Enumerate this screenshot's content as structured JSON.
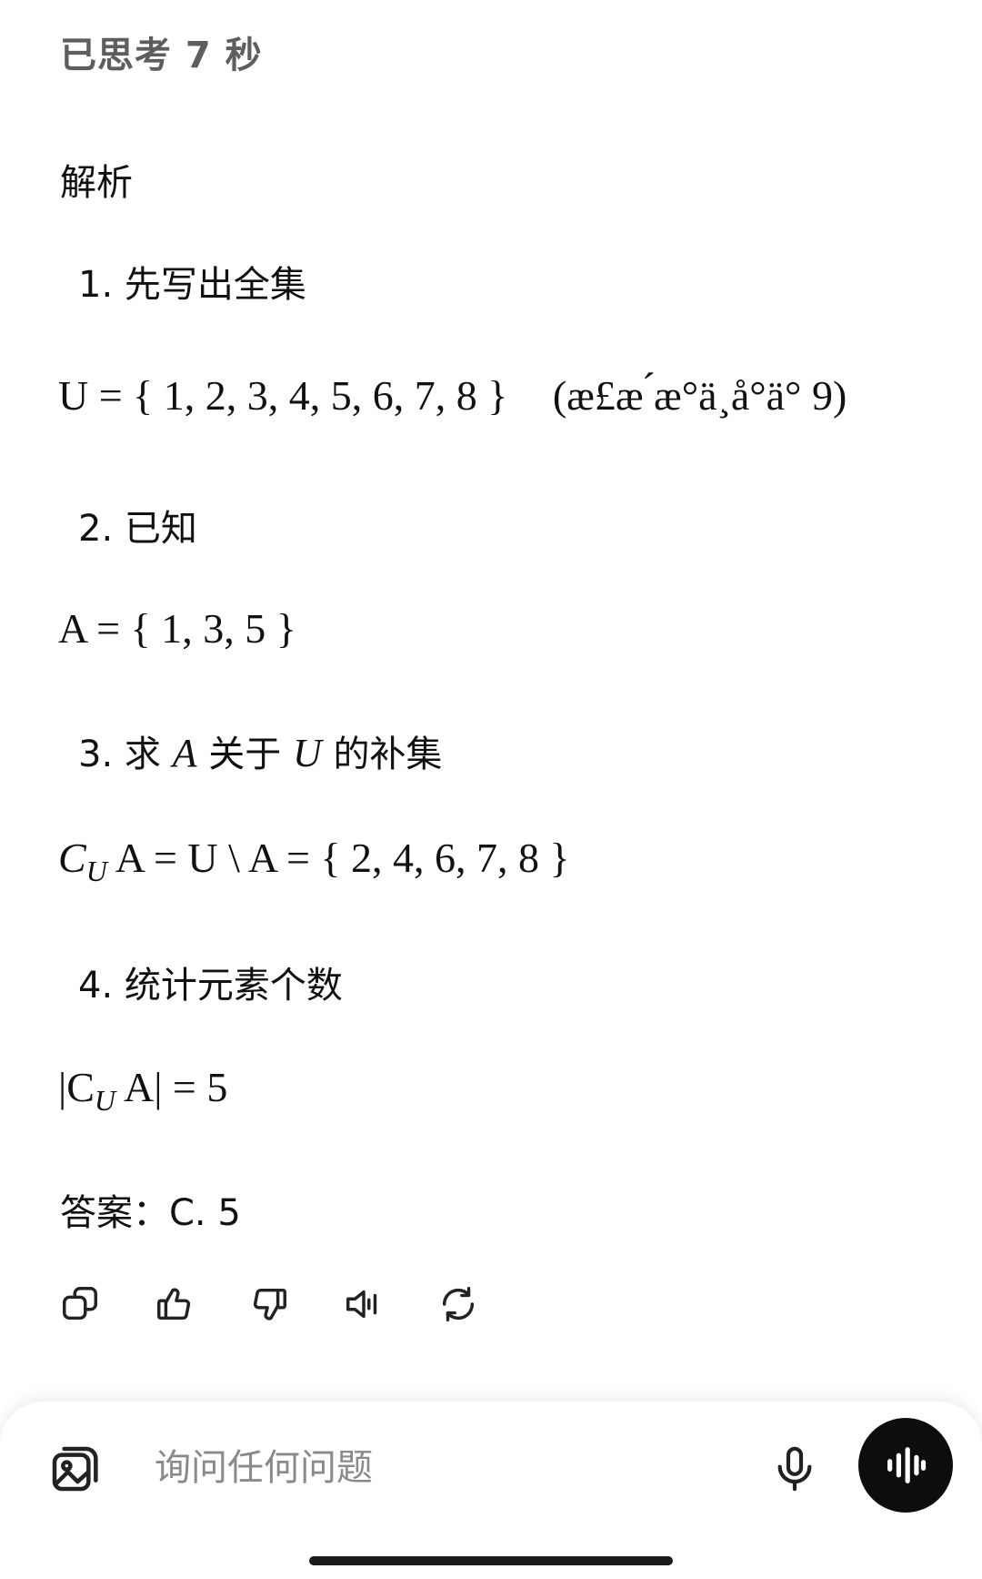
{
  "thinking_label": "已思考 7 秒",
  "heading": "解析",
  "steps": [
    {
      "number": "1.",
      "text": "先写出全集"
    },
    {
      "number": "2.",
      "text": "已知"
    },
    {
      "number": "3.",
      "text_a": "求",
      "math_a": "A",
      "text_b": "关于",
      "math_b": "U",
      "text_c": "的补集"
    },
    {
      "number": "4.",
      "text": "统计元素个数"
    }
  ],
  "equations": {
    "universe": "U = { 1, 2, 3, 4, 5, 6, 7, 8 }",
    "universe_note": "(æ£æ ́æ°ä¸å°ä° 9)",
    "set_a": "A = { 1, 3, 5 }",
    "complement_lhs": "C",
    "complement_sub": "U",
    "complement_rhs": "A = U \\ A = { 2, 4, 6, 7, 8 }",
    "count_lhs": "|C",
    "count_sub": "U",
    "count_rhs": "A| = 5"
  },
  "answer": "答案：C. 5",
  "actions": [
    "copy-icon",
    "thumbs-up-icon",
    "thumbs-down-icon",
    "read-aloud-icon",
    "regenerate-icon"
  ],
  "composer": {
    "placeholder": "询问任何问题"
  }
}
